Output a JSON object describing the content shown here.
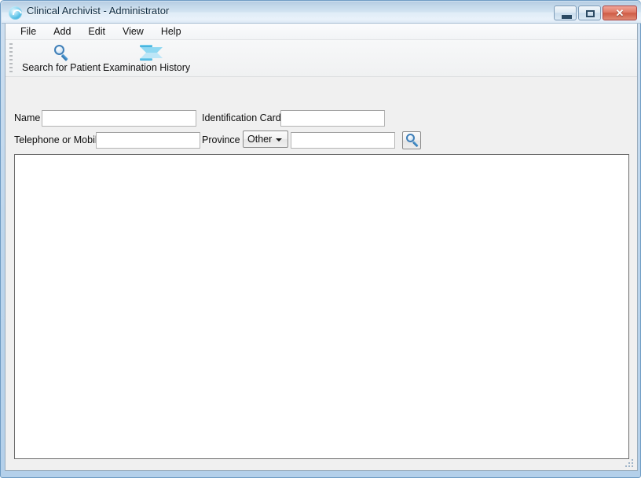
{
  "window": {
    "title": "Clinical Archivist - Administrator",
    "app_icon": "swirl-icon",
    "controls": {
      "minimize_label": "—",
      "maximize_label": "□",
      "close_label": "✕"
    }
  },
  "menubar": {
    "items": [
      {
        "label": "File"
      },
      {
        "label": "Add"
      },
      {
        "label": "Edit"
      },
      {
        "label": "View"
      },
      {
        "label": "Help"
      }
    ]
  },
  "toolbar": {
    "buttons": [
      {
        "label": "Search for Patient",
        "icon": "magnifier-icon"
      },
      {
        "label": "Examination History",
        "icon": "hourglass-icon"
      }
    ]
  },
  "search_form": {
    "name": {
      "label": "Name",
      "value": "",
      "placeholder": ""
    },
    "identification_card": {
      "label": "Identification Card",
      "value": "",
      "placeholder": ""
    },
    "telephone": {
      "label": "Telephone or Mobile",
      "value": "",
      "placeholder": ""
    },
    "province": {
      "label": "Province",
      "selected": "Other",
      "options": [
        "Other"
      ]
    },
    "province_detail": {
      "value": "",
      "placeholder": ""
    },
    "search_button": {
      "icon": "magnifier-icon",
      "tooltip": "Search"
    }
  },
  "results": {
    "rows": [],
    "empty_text": ""
  },
  "colors": {
    "frame": "#b4d0ea",
    "titlebar_top": "#b6cde2",
    "client_bg": "#f0f0f0",
    "accent_blue": "#3f7fb8",
    "close_red": "#cf5b45",
    "results_bg": "#ffffff"
  }
}
